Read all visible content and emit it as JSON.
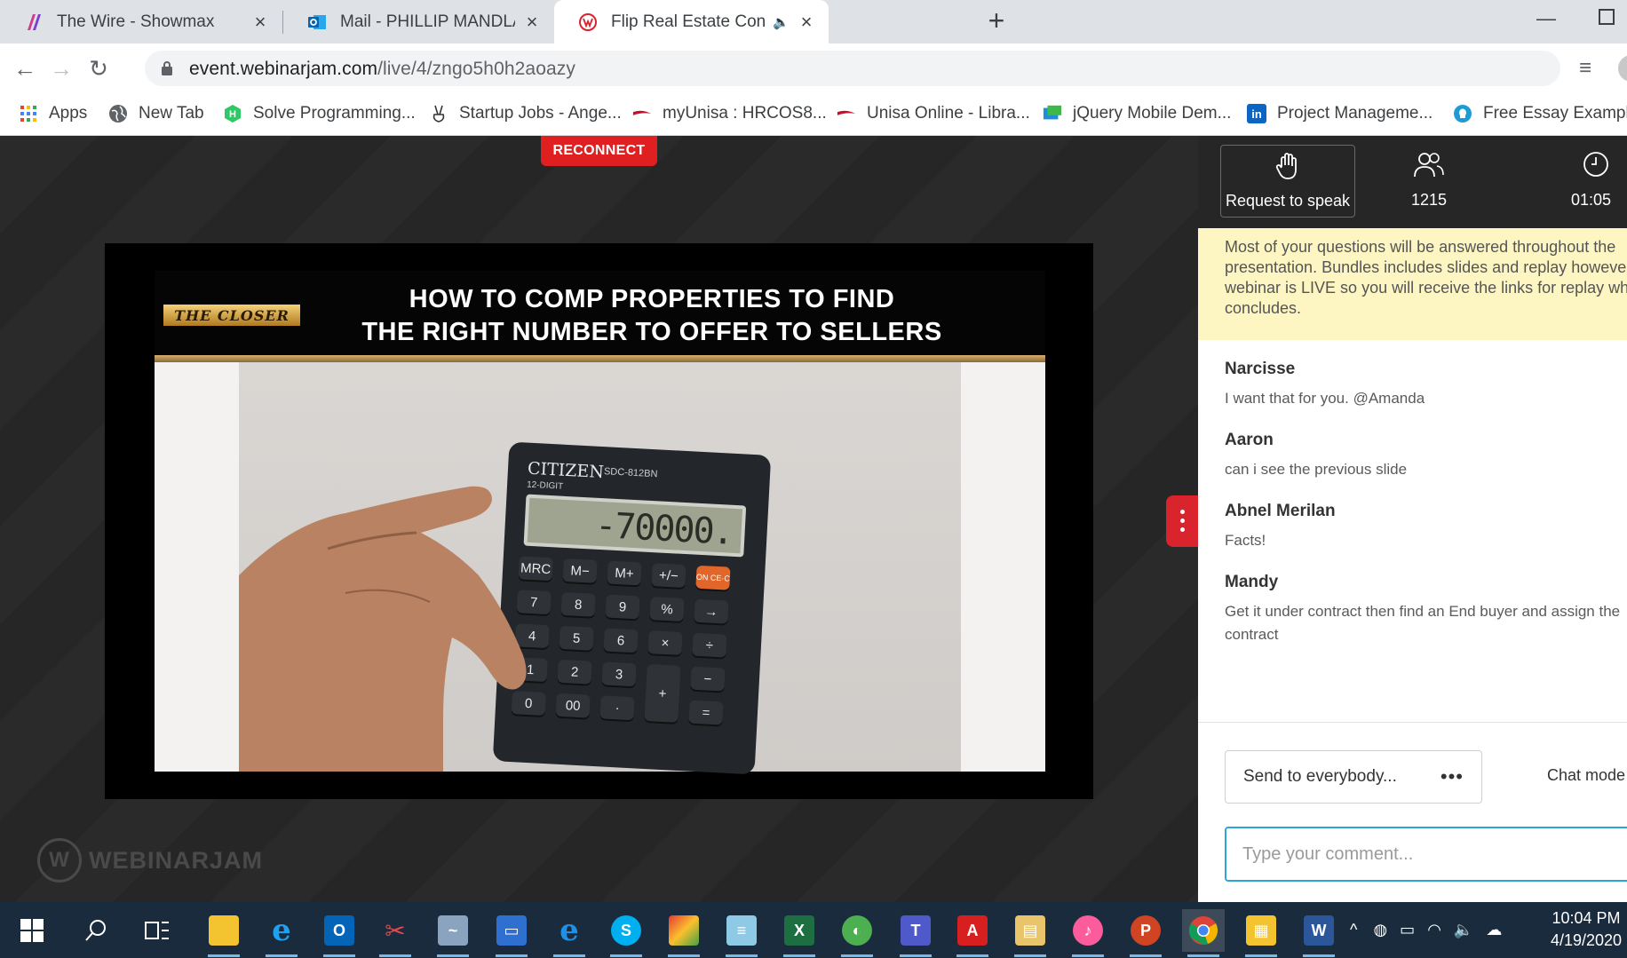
{
  "browser": {
    "tabs": [
      {
        "title": "The Wire - Showmax",
        "active": false
      },
      {
        "title": "Mail - PHILLIP MANDLA MTOMBENI - Outlook",
        "active": false
      },
      {
        "title": "Flip Real Estate Contracts Of",
        "active": true
      }
    ],
    "url_host": "event.webinarjam.com",
    "url_path": "/live/4/zngo5h0h2aoazy",
    "bookmarks": [
      {
        "label": "Apps",
        "icon": "apps-grid-icon"
      },
      {
        "label": "New Tab",
        "icon": "globe-icon"
      },
      {
        "label": "Solve Programming...",
        "icon": "hackerrank-icon"
      },
      {
        "label": "Startup Jobs - Ange...",
        "icon": "angellist-icon"
      },
      {
        "label": "myUnisa : HRCOS8...",
        "icon": "unisa-icon"
      },
      {
        "label": "Unisa Online - Libra...",
        "icon": "unisa-icon"
      },
      {
        "label": "jQuery Mobile Dem...",
        "icon": "jquery-mobile-icon"
      },
      {
        "label": "Project Manageme...",
        "icon": "linkedin-icon"
      },
      {
        "label": "Free Essay Example...",
        "icon": "lightbulb-icon"
      }
    ]
  },
  "webinar": {
    "reconnect_label": "RECONNECT",
    "slide": {
      "logo_text": "THE CLOSER",
      "title_line1": "HOW TO COMP PROPERTIES TO FIND",
      "title_line2": "THE RIGHT NUMBER TO OFFER TO SELLERS",
      "calculator_brand": "CITIZEN",
      "calculator_model": "SDC-812BN",
      "calculator_digits_label": "12-DIGIT",
      "calculator_reading": "-70000."
    },
    "brand_watermark": "WEBINARJAM"
  },
  "panel": {
    "request_to_speak": "Request to speak",
    "attendee_count": "1215",
    "elapsed_time": "01:05",
    "notice": "Most of your questions will be answered throughout the presentation. Bundles includes slides and replay however the webinar is LIVE so you will receive the links for replay when it concludes.",
    "messages": [
      {
        "author": "Narcisse",
        "text": "I want that for you. @Amanda"
      },
      {
        "author": "Aaron",
        "text": "can i see the previous slide"
      },
      {
        "author": "Abnel Merilan",
        "text": "Facts!"
      },
      {
        "author": "Mandy",
        "text": "Get it under contract then find an End buyer and assign the contract"
      }
    ],
    "send_to_label": "Send to everybody...",
    "chat_mode_label": "Chat mode",
    "comment_placeholder": "Type your comment..."
  },
  "taskbar": {
    "time": "10:04 PM",
    "date": "4/19/2020"
  },
  "colors": {
    "reconnect_red": "#e02020",
    "notice_yellow": "#fdf6c3",
    "input_focus_blue": "#2aa7d6",
    "taskbar": "#1a2b3d"
  }
}
